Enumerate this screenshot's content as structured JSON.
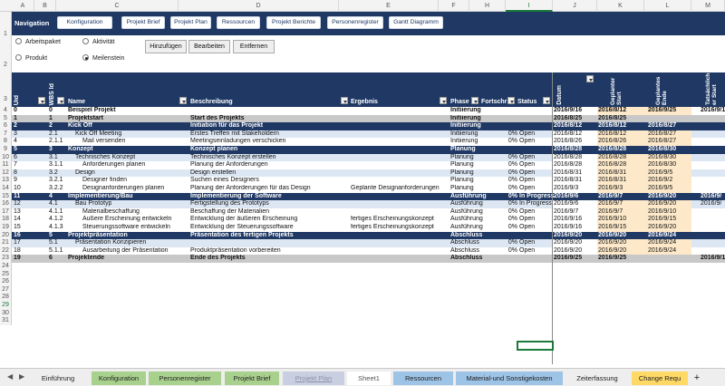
{
  "columns": [
    "A",
    "B",
    "C",
    "D",
    "E",
    "F",
    "H",
    "I",
    "J",
    "K",
    "L",
    "M"
  ],
  "nav": {
    "title": "Navigation",
    "buttons": [
      "Konfiguration",
      "Projekt Brief",
      "Projekt Plan",
      "Ressourcen",
      "Projekt Berichte",
      "Personenregister",
      "Gantt Diagramm"
    ]
  },
  "radios": [
    {
      "label": "Arbeitspaket",
      "checked": false
    },
    {
      "label": "Aktivität",
      "checked": false
    },
    {
      "label": "Produkt",
      "checked": false
    },
    {
      "label": "Meilenstein",
      "checked": true
    }
  ],
  "actions": [
    "Hinzufügen",
    "Bearbeiten",
    "Entfernen"
  ],
  "headers": {
    "uid": "Uid",
    "wbs": "WBS Id",
    "name": "Name",
    "desc": "Beschreibung",
    "result": "Ergebnis",
    "phase": "Phase",
    "progress": "Fortschr",
    "status": "Status",
    "date": "Datum",
    "planned_start": "Geplanter Start",
    "planned_end": "Geplantes Ende",
    "actual_start": "Tatsächlich er Start"
  },
  "rows": [
    {
      "r": "4",
      "uid": "0",
      "wbs": "0",
      "name": "Beispiel Projekt",
      "desc": "",
      "result": "",
      "phase": "Initiierung",
      "prog": "",
      "status": "",
      "date": "2016/9/16",
      "ps": "2016/8/12",
      "pe": "2016/9/25",
      "as": "2016/9/1",
      "type": "project",
      "indent": 0
    },
    {
      "r": "5",
      "uid": "1",
      "wbs": "1",
      "name": "Projektstart",
      "desc": "Start des Projekts",
      "result": "",
      "phase": "Initiierung",
      "prog": "",
      "status": "",
      "date": "2016/8/25",
      "ps": "2016/8/25",
      "pe": "",
      "as": "",
      "type": "grey",
      "indent": 0
    },
    {
      "r": "6",
      "uid": "2",
      "wbs": "2",
      "name": "Kick Off",
      "desc": "Initiation für das Projekt",
      "result": "",
      "phase": "Initiierung",
      "prog": "",
      "status": "",
      "date": "2016/8/12",
      "ps": "2016/8/12",
      "pe": "2016/8/27",
      "as": "",
      "type": "phase",
      "indent": 0
    },
    {
      "r": "7",
      "uid": "3",
      "wbs": "2.1",
      "name": "Kick Off Meeting",
      "desc": "Erstes Treffen mit Stakeholdern",
      "result": "",
      "phase": "Initiierung",
      "prog": "0%",
      "status": "Open",
      "date": "2016/8/12",
      "ps": "2016/8/12",
      "pe": "2016/8/27",
      "as": "",
      "type": "light",
      "indent": 1
    },
    {
      "r": "8",
      "uid": "4",
      "wbs": "2.1.1",
      "name": "Mail versenden",
      "desc": "Meetingseinladungen verschicken",
      "result": "",
      "phase": "Initiierung",
      "prog": "0%",
      "status": "Open",
      "date": "2016/8/26",
      "ps": "2016/8/26",
      "pe": "2016/8/27",
      "as": "",
      "type": "white",
      "indent": 2
    },
    {
      "r": "9",
      "uid": "5",
      "wbs": "3",
      "name": "Konzept",
      "desc": "Konzept planen",
      "result": "",
      "phase": "Planung",
      "prog": "",
      "status": "",
      "date": "2016/8/28",
      "ps": "2016/8/28",
      "pe": "2016/8/30",
      "as": "",
      "type": "phase",
      "indent": 0
    },
    {
      "r": "10",
      "uid": "6",
      "wbs": "3.1",
      "name": "Technisches Konzept",
      "desc": "Technisches Konzept erstellen",
      "result": "",
      "phase": "Planung",
      "prog": "0%",
      "status": "Open",
      "date": "2016/8/28",
      "ps": "2016/8/28",
      "pe": "2016/8/30",
      "as": "",
      "type": "light",
      "indent": 1
    },
    {
      "r": "11",
      "uid": "7",
      "wbs": "3.1.1",
      "name": "Anforderungen planen",
      "desc": "Planung der Anforderungen",
      "result": "",
      "phase": "Planung",
      "prog": "0%",
      "status": "Open",
      "date": "2016/8/28",
      "ps": "2016/8/28",
      "pe": "2016/8/30",
      "as": "",
      "type": "white",
      "indent": 2
    },
    {
      "r": "12",
      "uid": "8",
      "wbs": "3.2",
      "name": "Design",
      "desc": "Design erstellen",
      "result": "",
      "phase": "Planung",
      "prog": "0%",
      "status": "Open",
      "date": "2016/8/31",
      "ps": "2016/8/31",
      "pe": "2016/9/5",
      "as": "",
      "type": "light",
      "indent": 1
    },
    {
      "r": "13",
      "uid": "9",
      "wbs": "3.2.1",
      "name": "Designer finden",
      "desc": "Suchen eines Designers",
      "result": "",
      "phase": "Planung",
      "prog": "0%",
      "status": "Open",
      "date": "2016/8/31",
      "ps": "2016/8/31",
      "pe": "2016/9/2",
      "as": "",
      "type": "white",
      "indent": 2
    },
    {
      "r": "14",
      "uid": "10",
      "wbs": "3.2.2",
      "name": "Designanforderungen planen",
      "desc": "Planung der Anforderungen für das Design",
      "result": "Geplante Designanforderungen",
      "phase": "Planung",
      "prog": "0%",
      "status": "Open",
      "date": "2016/9/3",
      "ps": "2016/9/3",
      "pe": "2016/9/5",
      "as": "",
      "type": "white",
      "indent": 2
    },
    {
      "r": "15",
      "uid": "11",
      "wbs": "4",
      "name": "Implementierung/Bau",
      "desc": "Implementierung der Software",
      "result": "",
      "phase": "Ausführung",
      "prog": "0%",
      "status": "In Progress",
      "date": "2016/9/6",
      "ps": "2016/9/7",
      "pe": "2016/9/20",
      "as": "2016/9/",
      "type": "phase",
      "indent": 0
    },
    {
      "r": "16",
      "uid": "12",
      "wbs": "4.1",
      "name": "Bau Prototyp",
      "desc": "Fertigstellung des Prototyps",
      "result": "",
      "phase": "Ausführung",
      "prog": "0%",
      "status": "In Progress",
      "date": "2016/9/6",
      "ps": "2016/9/7",
      "pe": "2016/9/20",
      "as": "2016/9/",
      "type": "light",
      "indent": 1
    },
    {
      "r": "17",
      "uid": "13",
      "wbs": "4.1.1",
      "name": "Materialbeschaffung",
      "desc": "Beschaffung der Materialien",
      "result": "",
      "phase": "Ausführung",
      "prog": "0%",
      "status": "Open",
      "date": "2016/9/7",
      "ps": "2016/9/7",
      "pe": "2016/9/10",
      "as": "",
      "type": "white",
      "indent": 2
    },
    {
      "r": "18",
      "uid": "14",
      "wbs": "4.1.2",
      "name": "Äußere Erscheinung entwickeln",
      "desc": "Entwicklung der äußeren Erscheinung",
      "result": "fertiges Erscheinungskonzept",
      "phase": "Ausführung",
      "prog": "0%",
      "status": "Open",
      "date": "2016/9/16",
      "ps": "2016/9/10",
      "pe": "2016/9/15",
      "as": "",
      "type": "white",
      "indent": 2
    },
    {
      "r": "19",
      "uid": "15",
      "wbs": "4.1.3",
      "name": "Steuerungssoftware entwickeln",
      "desc": "Entwicklung der Steuerungssoftware",
      "result": "fertiges Erscheinungskonzept",
      "phase": "Ausführung",
      "prog": "0%",
      "status": "Open",
      "date": "2016/9/16",
      "ps": "2016/9/15",
      "pe": "2016/9/20",
      "as": "",
      "type": "white",
      "indent": 2
    },
    {
      "r": "20",
      "uid": "16",
      "wbs": "5",
      "name": "Projektpräsentation",
      "desc": "Präsentation des fertigen Projekts",
      "result": "",
      "phase": "Abschluss",
      "prog": "",
      "status": "",
      "date": "2016/9/20",
      "ps": "2016/9/20",
      "pe": "2016/9/24",
      "as": "",
      "type": "phase",
      "indent": 0
    },
    {
      "r": "21",
      "uid": "17",
      "wbs": "5.1",
      "name": "Präsentation Konzipieren",
      "desc": "",
      "result": "",
      "phase": "Abschluss",
      "prog": "0%",
      "status": "Open",
      "date": "2016/9/20",
      "ps": "2016/9/20",
      "pe": "2016/9/24",
      "as": "",
      "type": "light",
      "indent": 1
    },
    {
      "r": "22",
      "uid": "18",
      "wbs": "5.1.1",
      "name": "Ausarbeitung der Präsentation",
      "desc": "Produktpräsentation vorbereiten",
      "result": "",
      "phase": "Abschluss",
      "prog": "0%",
      "status": "Open",
      "date": "2016/9/20",
      "ps": "2016/9/20",
      "pe": "2016/9/24",
      "as": "",
      "type": "white",
      "indent": 2
    },
    {
      "r": "23",
      "uid": "19",
      "wbs": "6",
      "name": "Projektende",
      "desc": "Ende des Projekts",
      "result": "",
      "phase": "Abschluss",
      "prog": "",
      "status": "",
      "date": "2016/9/25",
      "ps": "2016/9/25",
      "pe": "",
      "as": "2016/9/1",
      "type": "grey",
      "indent": 0
    }
  ],
  "empty_rows": [
    "24",
    "25",
    "26",
    "27",
    "28",
    "29",
    "30",
    "31"
  ],
  "tabs": [
    "Einführung",
    "Konfiguration",
    "Personenregister",
    "Projekt Brief",
    "Projekt Plan",
    "Sheet1",
    "Ressourcen",
    "Material-und Sonstigekosten",
    "Zeiterfassung",
    "Change Requ"
  ],
  "add_tab": "+"
}
